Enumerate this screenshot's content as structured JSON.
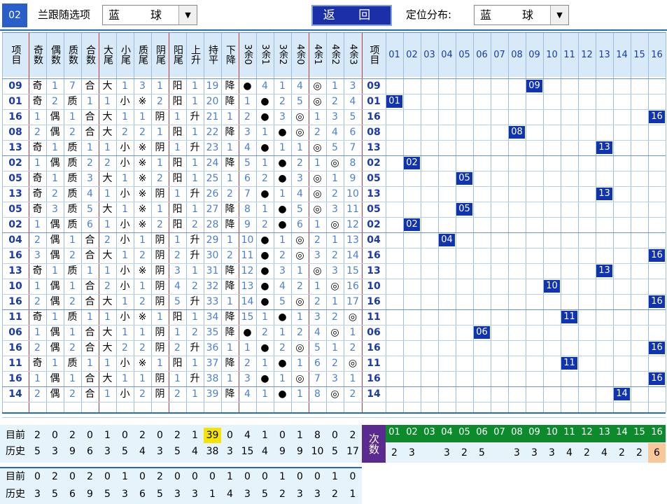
{
  "toolbar": {
    "number_badge": "02",
    "follow_label": "兰跟随选项",
    "follow_value": "蓝　球",
    "back_label": "返 回",
    "dist_label": "定位分布:",
    "dist_value": "蓝　球"
  },
  "headers": [
    "项目",
    "奇数",
    "偶数",
    "质数",
    "合数",
    "大尾",
    "小尾",
    "质尾",
    "阴尾",
    "阳尾",
    "上升",
    "持平",
    "下降",
    "3余0",
    "3余1",
    "3余2",
    "4余0",
    "4余1",
    "4余2",
    "4余3",
    "项目"
  ],
  "dist_headers": [
    "01",
    "02",
    "03",
    "04",
    "05",
    "06",
    "07",
    "08",
    "09",
    "10",
    "11",
    "12",
    "13",
    "14",
    "15",
    "16"
  ],
  "rows": [
    [
      "09",
      "奇",
      "1",
      "7",
      "合",
      "大",
      "1",
      "3",
      "1",
      "阳",
      "1",
      "19",
      "降",
      "●",
      "4",
      "1",
      "4",
      "◎",
      "1",
      "3"
    ],
    [
      "01",
      "奇",
      "2",
      "质",
      "1",
      "1",
      "小",
      "※",
      "2",
      "阳",
      "1",
      "20",
      "降",
      "1",
      "●",
      "2",
      "5",
      "◎",
      "2",
      "4"
    ],
    [
      "16",
      "1",
      "偶",
      "1",
      "合",
      "大",
      "1",
      "1",
      "阴",
      "1",
      "升",
      "21",
      "1",
      "2",
      "●",
      "3",
      "◎",
      "1",
      "3",
      "5"
    ],
    [
      "08",
      "2",
      "偶",
      "2",
      "合",
      "大",
      "2",
      "2",
      "1",
      "阳",
      "1",
      "22",
      "降",
      "3",
      "1",
      "●",
      "◎",
      "2",
      "4",
      "6"
    ],
    [
      "13",
      "奇",
      "1",
      "质",
      "1",
      "1",
      "小",
      "※",
      "阴",
      "1",
      "升",
      "23",
      "1",
      "4",
      "●",
      "1",
      "1",
      "◎",
      "5",
      "7"
    ],
    [
      "02",
      "1",
      "偶",
      "质",
      "2",
      "2",
      "小",
      "※",
      "1",
      "阳",
      "1",
      "24",
      "降",
      "5",
      "1",
      "●",
      "2",
      "1",
      "◎",
      "8"
    ],
    [
      "05",
      "奇",
      "1",
      "质",
      "3",
      "大",
      "1",
      "※",
      "2",
      "阳",
      "1",
      "25",
      "1",
      "6",
      "2",
      "●",
      "3",
      "◎",
      "1",
      "9"
    ],
    [
      "13",
      "奇",
      "2",
      "质",
      "4",
      "1",
      "小",
      "※",
      "阴",
      "1",
      "升",
      "26",
      "2",
      "7",
      "●",
      "1",
      "4",
      "◎",
      "2",
      "10"
    ],
    [
      "05",
      "奇",
      "3",
      "质",
      "5",
      "大",
      "1",
      "※",
      "1",
      "阳",
      "1",
      "27",
      "降",
      "8",
      "1",
      "●",
      "5",
      "◎",
      "3",
      "11"
    ],
    [
      "02",
      "1",
      "偶",
      "质",
      "6",
      "1",
      "小",
      "※",
      "2",
      "阳",
      "2",
      "28",
      "降",
      "9",
      "2",
      "●",
      "6",
      "1",
      "◎",
      "12"
    ],
    [
      "04",
      "2",
      "偶",
      "1",
      "合",
      "2",
      "小",
      "1",
      "阴",
      "1",
      "升",
      "29",
      "1",
      "10",
      "●",
      "1",
      "◎",
      "2",
      "1",
      "13"
    ],
    [
      "16",
      "3",
      "偶",
      "2",
      "合",
      "大",
      "1",
      "2",
      "阴",
      "2",
      "升",
      "30",
      "2",
      "11",
      "●",
      "2",
      "◎",
      "3",
      "2",
      "14"
    ],
    [
      "13",
      "奇",
      "1",
      "质",
      "1",
      "1",
      "小",
      "※",
      "阴",
      "3",
      "1",
      "31",
      "降",
      "12",
      "●",
      "3",
      "1",
      "◎",
      "3",
      "15"
    ],
    [
      "10",
      "1",
      "偶",
      "1",
      "合",
      "2",
      "小",
      "1",
      "阴",
      "4",
      "2",
      "32",
      "降",
      "13",
      "●",
      "4",
      "2",
      "1",
      "◎",
      "16"
    ],
    [
      "16",
      "2",
      "偶",
      "2",
      "合",
      "大",
      "1",
      "2",
      "阴",
      "5",
      "升",
      "33",
      "1",
      "14",
      "●",
      "5",
      "◎",
      "2",
      "1",
      "17"
    ],
    [
      "11",
      "奇",
      "1",
      "质",
      "1",
      "1",
      "小",
      "※",
      "1",
      "阳",
      "1",
      "34",
      "降",
      "15",
      "1",
      "●",
      "1",
      "3",
      "2",
      "◎"
    ],
    [
      "06",
      "1",
      "偶",
      "1",
      "合",
      "大",
      "1",
      "1",
      "阴",
      "1",
      "2",
      "35",
      "降",
      "●",
      "2",
      "1",
      "2",
      "4",
      "◎",
      "1"
    ],
    [
      "16",
      "2",
      "偶",
      "2",
      "合",
      "大",
      "2",
      "2",
      "阴",
      "2",
      "升",
      "36",
      "1",
      "1",
      "●",
      "2",
      "◎",
      "5",
      "1",
      "2"
    ],
    [
      "11",
      "奇",
      "1",
      "质",
      "1",
      "1",
      "小",
      "※",
      "1",
      "阳",
      "1",
      "37",
      "降",
      "2",
      "1",
      "●",
      "1",
      "6",
      "2",
      "◎"
    ],
    [
      "16",
      "1",
      "偶",
      "1",
      "合",
      "大",
      "1",
      "1",
      "阴",
      "1",
      "升",
      "38",
      "1",
      "3",
      "●",
      "1",
      "◎",
      "7",
      "3",
      "1"
    ],
    [
      "14",
      "2",
      "偶",
      "2",
      "合",
      "1",
      "小",
      "2",
      "阴",
      "2",
      "1",
      "39",
      "降",
      "4",
      "1",
      "●",
      "1",
      "8",
      "◎",
      "2"
    ]
  ],
  "bottom": {
    "current_label": "目前",
    "history_label": "历史",
    "times_label": "次数",
    "current": [
      "2",
      "0",
      "2",
      "0",
      "1",
      "0",
      "2",
      "0",
      "2",
      "1",
      "39",
      "0",
      "4",
      "1",
      "0",
      "1",
      "8",
      "0",
      "2"
    ],
    "history": [
      "5",
      "3",
      "9",
      "6",
      "3",
      "5",
      "4",
      "3",
      "5",
      "4",
      "38",
      "3",
      "15",
      "4",
      "9",
      "9",
      "10",
      "5",
      "17"
    ],
    "dist_history": [
      "2",
      "3",
      "",
      "3",
      "2",
      "5",
      "",
      "3",
      "3",
      "3",
      "4",
      "2",
      "4",
      "2",
      "2",
      "6"
    ],
    "current2": [
      "0",
      "2",
      "0",
      "2",
      "0",
      "1",
      "0",
      "2",
      "0",
      "0",
      "0",
      "1",
      "0",
      "0",
      "1",
      "0",
      "0",
      "1",
      "0"
    ],
    "history2": [
      "3",
      "5",
      "6",
      "9",
      "5",
      "3",
      "6",
      "5",
      "3",
      "3",
      "1",
      "4",
      "3",
      "5",
      "2",
      "3",
      "3",
      "2",
      "1"
    ]
  },
  "colors": {
    "blue_num": "#1a3aa8",
    "light_num": "#4a7fd6",
    "red_line": "#d83030",
    "box": "#1033b0",
    "header_bg": "#d8eaf8",
    "green": "#0c8a2c",
    "purple": "#5a2a8e",
    "yellow": "#f5e400",
    "orange_cell": "#f8c79a"
  }
}
